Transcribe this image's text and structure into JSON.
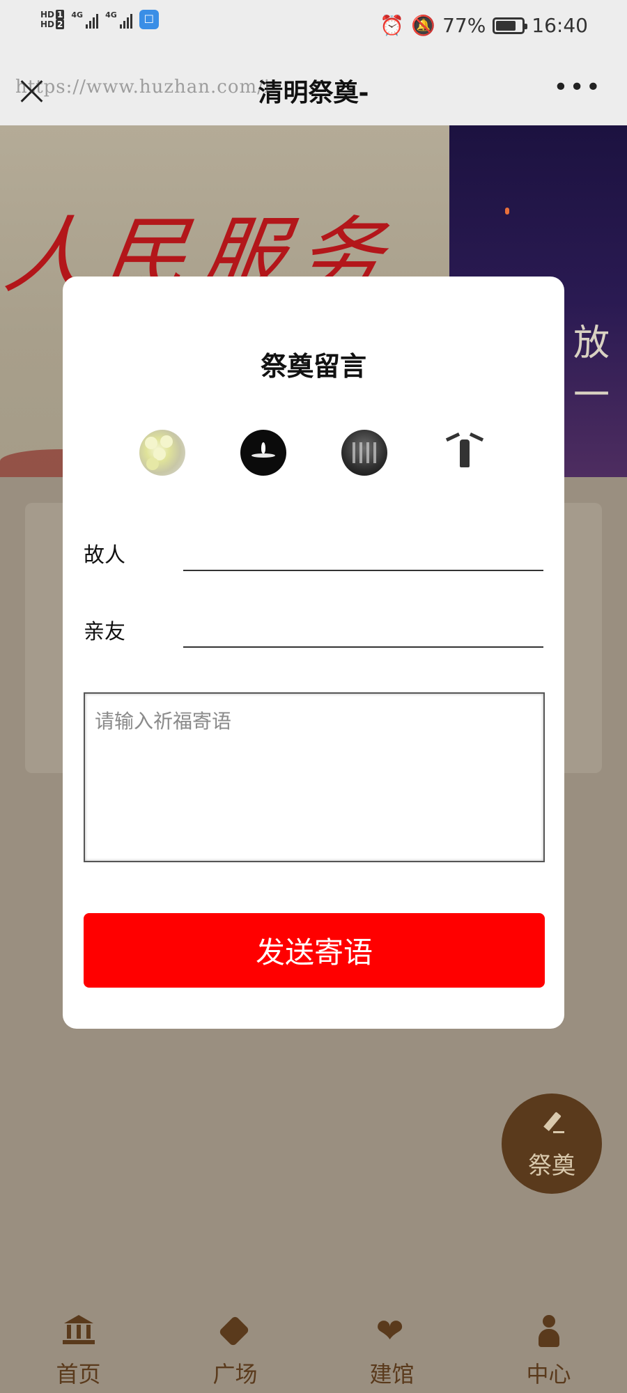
{
  "status_bar": {
    "hd1": "HD",
    "hd1_num": "1",
    "hd2": "HD",
    "hd2_num": "2",
    "net1": "4G",
    "net2": "4G",
    "battery_pct": "77%",
    "battery_level": 0.77,
    "time": "16:40"
  },
  "header": {
    "title": "清明祭奠-",
    "watermark": "https://www.huzhan.com/i"
  },
  "banner": {
    "calligraphy": "人民服务",
    "right_text": "放一"
  },
  "modal": {
    "title": "祭奠留言",
    "offerings": [
      "chrysanthemum-icon",
      "candle-icon",
      "incense-icon",
      "bronze-vessel-icon"
    ],
    "deceased_label": "故人",
    "deceased_value": "",
    "relative_label": "亲友",
    "relative_value": "",
    "message_placeholder": "请输入祈福寄语",
    "send_label": "发送寄语"
  },
  "fab": {
    "label": "祭奠"
  },
  "bottom_nav": {
    "items": [
      {
        "label": "首页",
        "icon": "bank-icon"
      },
      {
        "label": "广场",
        "icon": "tag-icon"
      },
      {
        "label": "建馆",
        "icon": "heart-icon"
      },
      {
        "label": "中心",
        "icon": "person-icon"
      }
    ]
  },
  "colors": {
    "accent": "#ff0000",
    "brand": "#5a3a1c",
    "overlay": "#9a8f80"
  }
}
